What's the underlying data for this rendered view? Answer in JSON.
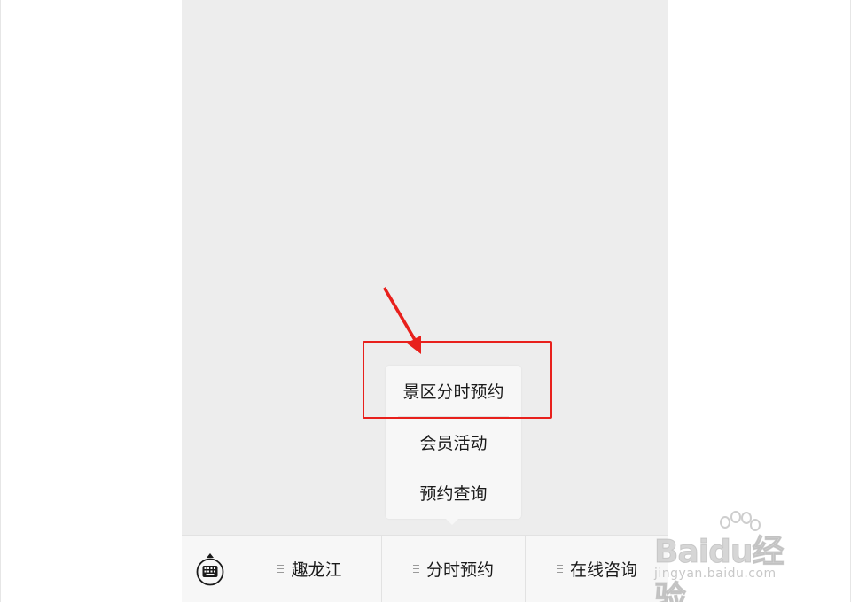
{
  "submenu": {
    "items": [
      "景区分时预约",
      "会员活动",
      "预约查询"
    ]
  },
  "menubar": {
    "keyboard_icon": "keyboard-icon",
    "tabs": [
      {
        "label": "趣龙江",
        "icon": "menu-lines-icon"
      },
      {
        "label": "分时预约",
        "icon": "menu-lines-icon"
      },
      {
        "label": "在线咨询",
        "icon": "menu-lines-icon"
      }
    ]
  },
  "annotation": {
    "highlight_color": "#e8201c"
  },
  "watermark": {
    "brand": "Baidu经验",
    "url": "jingyan.baidu.com"
  },
  "colors": {
    "screen_bg": "#ededed",
    "bar_bg": "#f7f7f7",
    "text": "#1a1a1a"
  }
}
